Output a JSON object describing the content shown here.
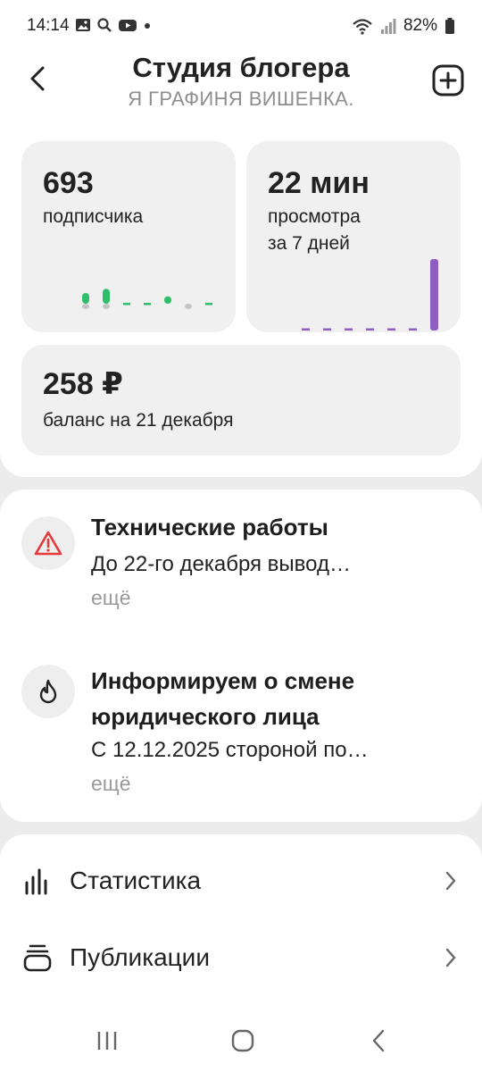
{
  "status_bar": {
    "time": "14:14",
    "left_icons": [
      "gallery-icon",
      "search-icon",
      "youtube-icon",
      "dot-icon"
    ],
    "battery": "82%",
    "right_icons": [
      "wifi-icon",
      "signal-icon",
      "battery-icon"
    ]
  },
  "header": {
    "title": "Студия блогера",
    "subtitle": "Я ГРАФИНЯ ВИШЕНКА.",
    "back_icon": "back-arrow-icon",
    "add_icon": "add-square-icon"
  },
  "stats": {
    "subscribers": {
      "value": "693",
      "label": "подписчика",
      "sparkline": [
        {
          "up": 1,
          "down": 1
        },
        {
          "up": 1.4,
          "down": 1
        },
        {
          "up": 0,
          "down": 0
        },
        {
          "up": 0,
          "down": 0
        },
        {
          "up": 0.7,
          "down": 0
        },
        {
          "up": 0,
          "down": 1
        },
        {
          "up": 0,
          "down": 0
        }
      ]
    },
    "views": {
      "value": "22 мин",
      "label_line1": "просмотра",
      "label_line2": "за 7 дней",
      "bars": [
        0,
        0,
        0,
        0,
        0,
        0,
        1
      ]
    },
    "balance": {
      "value": "258 ₽",
      "label": "баланс на 21 декабря"
    }
  },
  "notices": [
    {
      "icon": "warning-icon",
      "title": "Технические работы",
      "text": "До 22-го декабря вывод…",
      "more": "ещё"
    },
    {
      "icon": "flame-icon",
      "title_line1": "Информируем о смене",
      "title_line2": "юридического лица",
      "text": "С 12.12.2025 стороной по…",
      "more": "ещё"
    }
  ],
  "menu": [
    {
      "icon": "bar-chart-icon",
      "label": "Статистика"
    },
    {
      "icon": "publications-icon",
      "label": "Публикации"
    }
  ],
  "colors": {
    "accent_green": "#2fbf6a",
    "accent_purple": "#8e5fc0",
    "warning_red": "#e5393b",
    "muted_gray": "#9a9a9a"
  }
}
